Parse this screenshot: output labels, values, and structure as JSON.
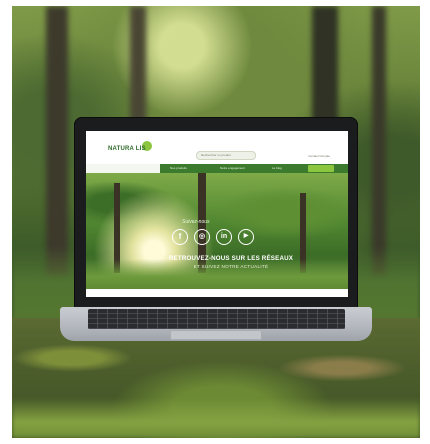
{
  "scene": {
    "description_colors": {
      "forest_dark": "#2e4a25",
      "forest_light": "#7f9a48",
      "moss": "#6f8d36"
    }
  },
  "website": {
    "logo_text": "NATURA LIS",
    "search_placeholder": "Rechercher un produit",
    "top_links": "Contact  Compte",
    "nav_items": [
      "Nos produits",
      "Notre engagement",
      "Le blog"
    ],
    "nav_cta": "Boutique",
    "social_label": "Suivez-nous",
    "social_icons": [
      "facebook-icon",
      "instagram-icon",
      "linkedin-icon",
      "youtube-icon"
    ],
    "hero_title": "RETROUVEZ-NOUS SUR LES RÉSEAUX",
    "hero_subtitle": "ET SUIVEZ NOTRE ACTUALITÉ",
    "colors": {
      "brand_green": "#3c7a2e",
      "accent_green": "#8cc63f"
    }
  }
}
